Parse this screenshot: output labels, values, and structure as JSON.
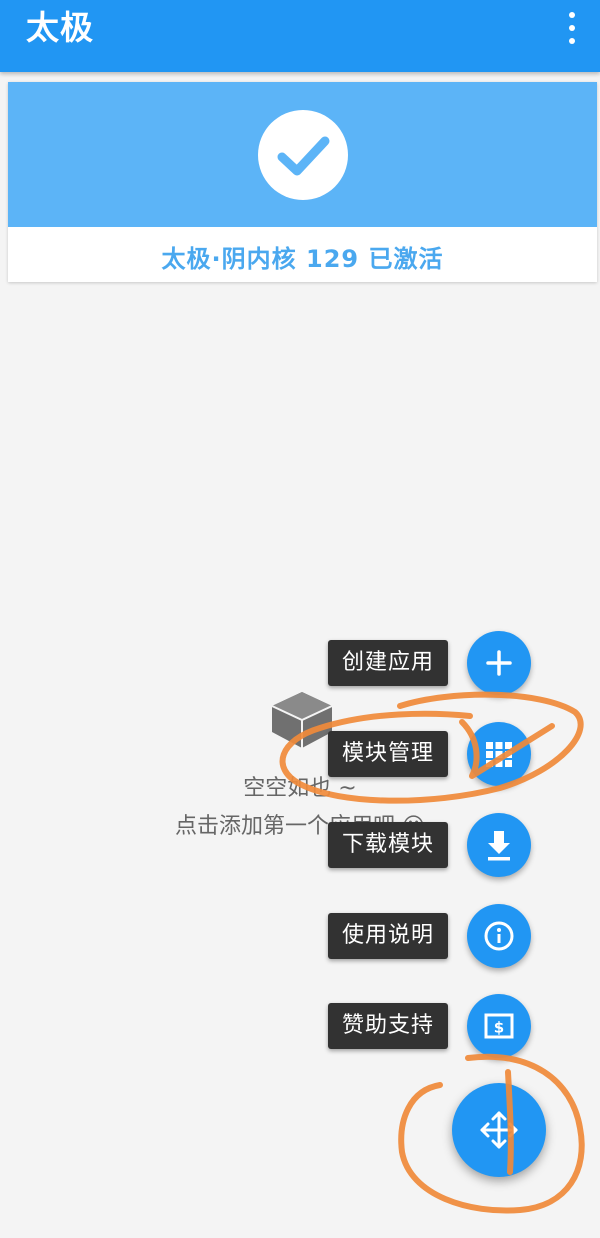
{
  "app": {
    "title": "太极",
    "menu_icon": "more-vert-icon"
  },
  "colors": {
    "primary": "#2196f3",
    "banner": "#5cb4f7",
    "status_text": "#4aa8ef",
    "label_bg": "#323232",
    "annotation": "#f08a3a"
  },
  "status": {
    "icon": "check-icon",
    "text": "太极·阴内核 129 已激活"
  },
  "empty_state": {
    "icon": "empty-box-icon",
    "line1": "空空如也 ~",
    "line2": "点击添加第一个应用吧 ☺"
  },
  "fab_menu": {
    "items": [
      {
        "label": "创建应用",
        "icon": "plus-icon"
      },
      {
        "label": "模块管理",
        "icon": "grid-icon"
      },
      {
        "label": "下载模块",
        "icon": "download-icon"
      },
      {
        "label": "使用说明",
        "icon": "info-icon"
      },
      {
        "label": "赞助支持",
        "icon": "dollar-icon"
      }
    ],
    "main_icon": "move-icon"
  }
}
